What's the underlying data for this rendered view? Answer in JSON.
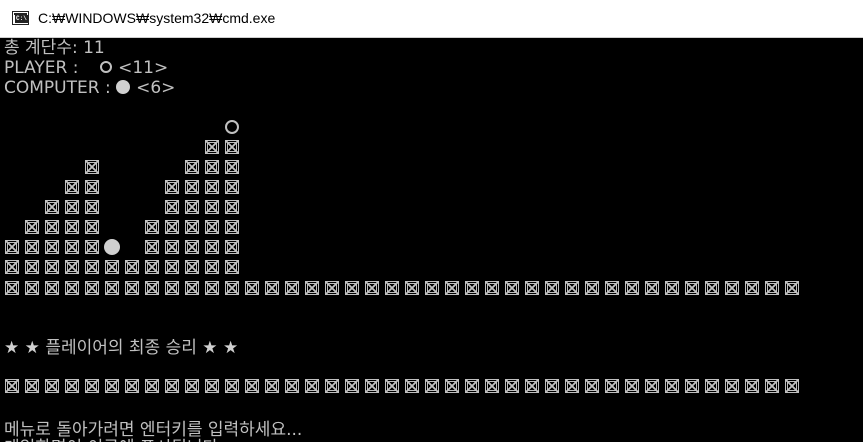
{
  "window": {
    "title": "C:₩WINDOWS₩system32₩cmd.exe",
    "icon": "cmd-icon",
    "icon_text": "C:\\"
  },
  "console": {
    "total_rows_line": "총 계단수: 11",
    "player_label": "PLAYER :",
    "player_symbol": "white-circle",
    "player_value": "<11>",
    "computer_label": "COMPUTER :",
    "computer_symbol": "gray-circle",
    "computer_value": "<6>",
    "win_message": "플레이어의 최종 승리",
    "star_glyph": "★",
    "prompt": "메뉴로 돌아가려면 엔터키를 입력하세요...",
    "partial_line": "게임화면이 이곳에 표시됩니다"
  },
  "board": {
    "columns": [
      1,
      2,
      3,
      4,
      5,
      0,
      0,
      2,
      4,
      5,
      6,
      6
    ],
    "player_stone_column": 11,
    "computer_stone_column": 5
  },
  "dividers": {
    "count": 40
  }
}
